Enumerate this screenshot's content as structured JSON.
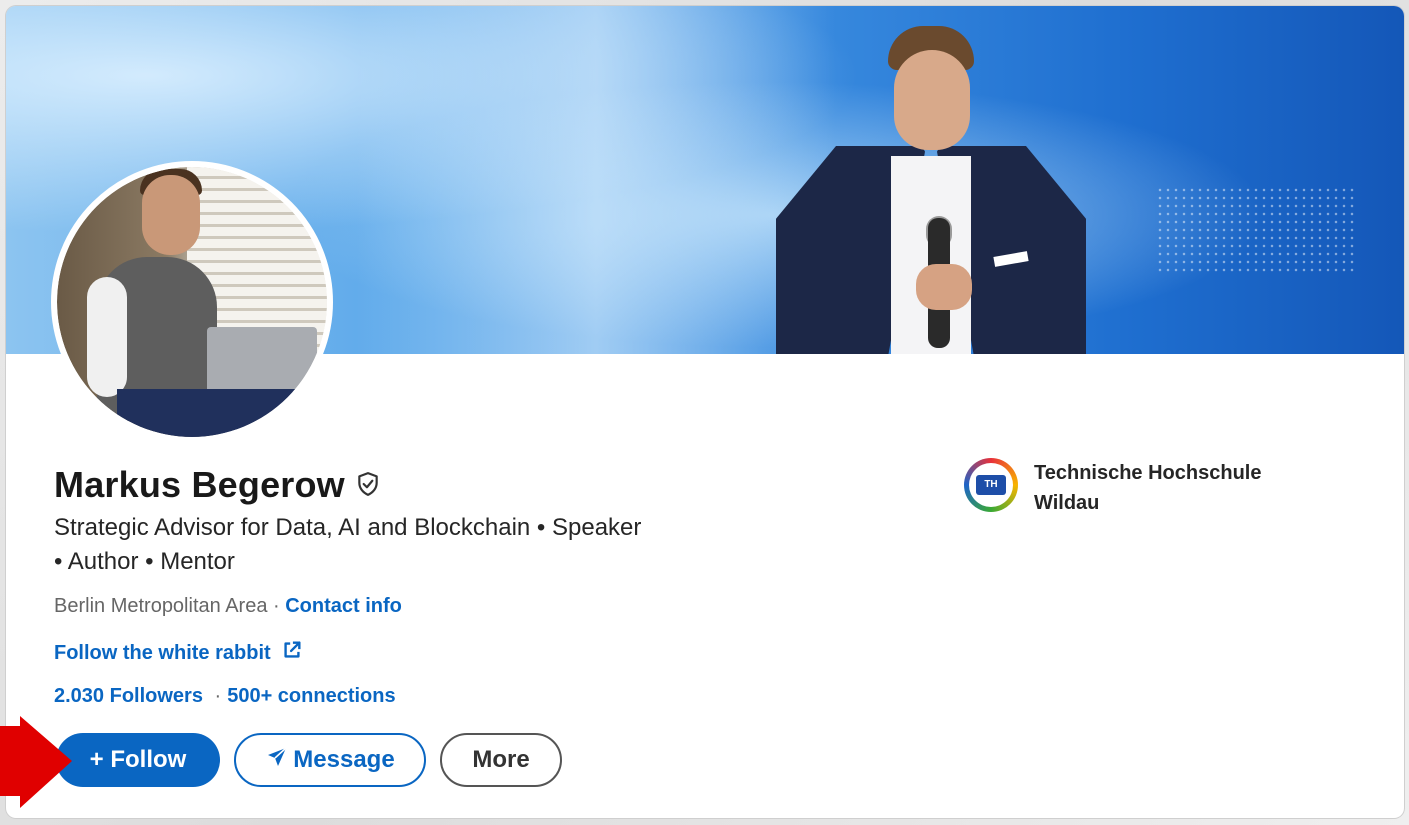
{
  "profile": {
    "name": "Markus Begerow",
    "headline": "Strategic Advisor for Data, AI and Blockchain • Speaker • Author • Mentor",
    "location": "Berlin Metropolitan Area",
    "location_separator": " · ",
    "contact_info": "Contact info",
    "website": "Follow the white rabbit",
    "followers": "2.030 Followers",
    "stats_separator": "·",
    "connections": "500+ connections"
  },
  "actions": {
    "follow": "+ Follow",
    "message": "Message",
    "more": "More"
  },
  "education": {
    "school_name": "Technische Hochschule Wildau",
    "logo_text": "TH"
  },
  "colors": {
    "link_blue": "#0a66c2",
    "annotation_arrow": "#e00000"
  }
}
